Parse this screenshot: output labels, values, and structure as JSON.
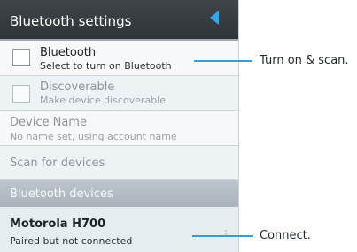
{
  "header": {
    "title": "Bluetooth settings",
    "back_icon": "back-triangle-icon",
    "accent_color": "#35a7e8"
  },
  "settings": {
    "bluetooth": {
      "title": "Bluetooth",
      "subtitle": "Select to turn on Bluetooth",
      "checked": false
    },
    "discoverable": {
      "title": "Discoverable",
      "subtitle": "Make device discoverable",
      "checked": false,
      "enabled": false
    },
    "device_name": {
      "title": "Device Name",
      "subtitle": "No name set, using account name"
    },
    "scan": {
      "title": "Scan for devices"
    }
  },
  "devices_section": {
    "header": "Bluetooth devices"
  },
  "devices": [
    {
      "name": "Motorola H700",
      "status": "Paired but not connected"
    }
  ],
  "callouts": {
    "turn_on": "Turn on & scan.",
    "connect": "Connect.",
    "line_color": "#2fa0d8"
  }
}
